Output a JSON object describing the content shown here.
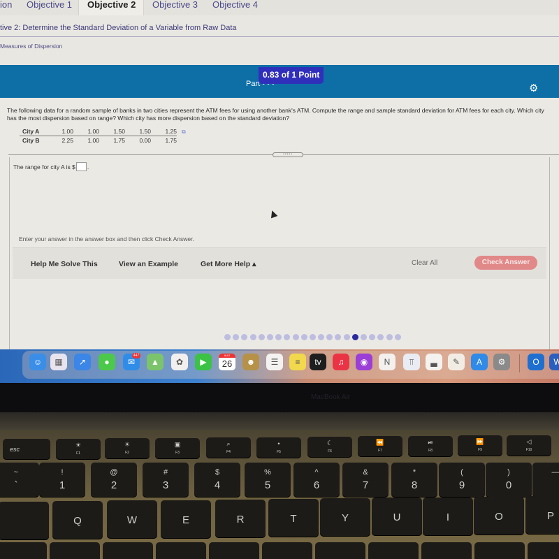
{
  "tabs": [
    {
      "label": "ion",
      "active": false
    },
    {
      "label": "Objective 1",
      "active": false
    },
    {
      "label": "Objective 2",
      "active": true
    },
    {
      "label": "Objective 3",
      "active": false
    },
    {
      "label": "Objective 4",
      "active": false
    }
  ],
  "objective_title": "tive 2: Determine the Standard Deviation of a Variable from Raw Data",
  "section_label": "Measures of Dispersion",
  "header": {
    "part_label": "Part • • •",
    "points_badge": "0.83 of 1 Point",
    "settings_icon": "⚙"
  },
  "question": {
    "text": "The following data for a random sample of banks in two cities represent the ATM fees for using another bank's ATM. Compute the range and sample standard deviation for ATM fees for each city. Which city has the most dispersion based on range? Which city has more dispersion based on the standard deviation?",
    "table": {
      "rows": [
        {
          "label": "City A",
          "values": [
            "1.00",
            "1.00",
            "1.50",
            "1.50",
            "1.25"
          ]
        },
        {
          "label": "City B",
          "values": [
            "2.25",
            "1.00",
            "1.75",
            "0.00",
            "1.75"
          ]
        }
      ]
    },
    "copy_icon": "⧉",
    "divider_handle": "•••••",
    "answer_prompt": "The range for city A is $",
    "answer_value": "",
    "answer_suffix": "."
  },
  "instructions": "Enter your answer in the answer box and then click Check Answer.",
  "actions": {
    "help_me_solve": "Help Me Solve This",
    "view_example": "View an Example",
    "get_more_help": "Get More Help ▴",
    "clear_all": "Clear All",
    "check_answer": "Check Answer"
  },
  "progress": {
    "total": 21,
    "current": 16
  },
  "dock": {
    "mail_badge": "447",
    "calendar_month": "AUG",
    "calendar_day": "26",
    "apps": [
      {
        "name": "Finder",
        "glyph": "☺",
        "color": "#3a8ee8"
      },
      {
        "name": "Launchpad",
        "glyph": "▦",
        "color": "#e8e4ee"
      },
      {
        "name": "Safari",
        "glyph": "↗",
        "color": "#3b86e6"
      },
      {
        "name": "Messages",
        "glyph": "●",
        "color": "#4cc94a"
      },
      {
        "name": "Mail",
        "glyph": "✉",
        "color": "#2f8de8"
      },
      {
        "name": "Maps",
        "glyph": "▲",
        "color": "#7bc46b"
      },
      {
        "name": "Photos",
        "glyph": "✿",
        "color": "#f2f0ee"
      },
      {
        "name": "FaceTime",
        "glyph": "▶",
        "color": "#3cc244"
      },
      {
        "name": "Calendar",
        "glyph": "",
        "color": "#ffffff"
      },
      {
        "name": "Contacts",
        "glyph": "☻",
        "color": "#b59247"
      },
      {
        "name": "Reminders",
        "glyph": "☰",
        "color": "#f4f2f0"
      },
      {
        "name": "Notes",
        "glyph": "≡",
        "color": "#f2d84c"
      },
      {
        "name": "TV",
        "glyph": "tv",
        "color": "#1e1e1e"
      },
      {
        "name": "Music",
        "glyph": "♫",
        "color": "#ea3446"
      },
      {
        "name": "Podcasts",
        "glyph": "◉",
        "color": "#9b3ed6"
      },
      {
        "name": "News",
        "glyph": "N",
        "color": "#f3f0ee"
      },
      {
        "name": "Keynote",
        "glyph": "⫪",
        "color": "#e9ecf2"
      },
      {
        "name": "Numbers",
        "glyph": "▃",
        "color": "#f4f2ee"
      },
      {
        "name": "Pages",
        "glyph": "✎",
        "color": "#f2ede4"
      },
      {
        "name": "App Store",
        "glyph": "A",
        "color": "#2f8ae8"
      },
      {
        "name": "System Preferences",
        "glyph": "⚙",
        "color": "#8a8a8a"
      },
      {
        "name": "Outlook",
        "glyph": "O",
        "color": "#1f6fd0"
      },
      {
        "name": "Word",
        "glyph": "W",
        "color": "#2b5fbf"
      }
    ]
  },
  "bezel_label": "MacBook Air",
  "keyboard": {
    "esc": "esc",
    "fkeys": [
      {
        "icon": "☀",
        "label": "F1"
      },
      {
        "icon": "☀",
        "label": "F2"
      },
      {
        "icon": "▣",
        "label": "F3"
      },
      {
        "icon": "⌕",
        "label": "F4"
      },
      {
        "icon": "•",
        "label": "F5"
      },
      {
        "icon": "☾",
        "label": "F6"
      },
      {
        "icon": "⏪",
        "label": "F7"
      },
      {
        "icon": "⏯",
        "label": "F8"
      },
      {
        "icon": "⏩",
        "label": "F9"
      },
      {
        "icon": "◁",
        "label": "F10"
      }
    ],
    "number_row": [
      {
        "up": "~",
        "dn": "`"
      },
      {
        "up": "!",
        "dn": "1"
      },
      {
        "up": "@",
        "dn": "2"
      },
      {
        "up": "#",
        "dn": "3"
      },
      {
        "up": "$",
        "dn": "4"
      },
      {
        "up": "%",
        "dn": "5"
      },
      {
        "up": "^",
        "dn": "6"
      },
      {
        "up": "&",
        "dn": "7"
      },
      {
        "up": "*",
        "dn": "8"
      },
      {
        "up": "(",
        "dn": "9"
      },
      {
        "up": ")",
        "dn": "0"
      },
      {
        "up": "—",
        "dn": ""
      }
    ],
    "letter_row": [
      "",
      "Q",
      "W",
      "E",
      "R",
      "T",
      "Y",
      "U",
      "I",
      "O",
      "P"
    ]
  }
}
